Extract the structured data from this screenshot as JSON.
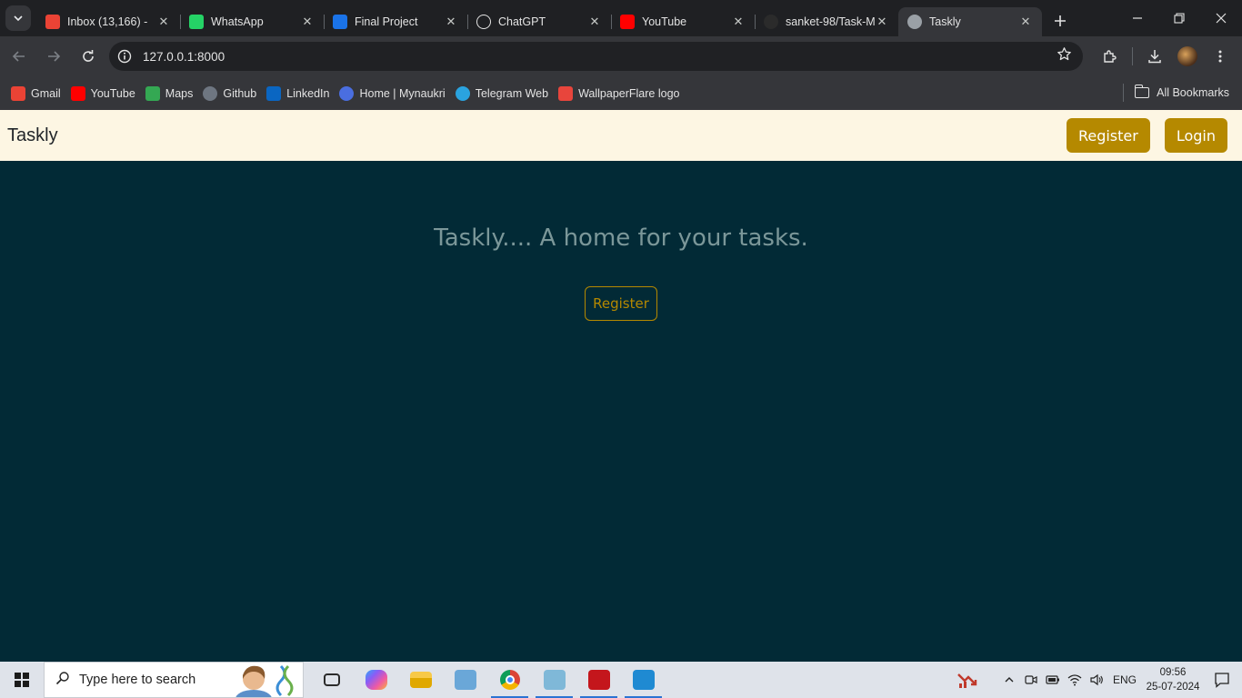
{
  "browser": {
    "tabs": [
      {
        "title": "Inbox (13,166) -",
        "favicon": "gmail-icon",
        "color": "#ea4335",
        "active": false
      },
      {
        "title": "WhatsApp",
        "favicon": "whatsapp-icon",
        "color": "#25d366",
        "active": false
      },
      {
        "title": "Final Project",
        "favicon": "google-classroom-icon",
        "color": "#1a73e8",
        "active": false
      },
      {
        "title": "ChatGPT",
        "favicon": "chatgpt-icon",
        "color": "#ffffff",
        "active": false
      },
      {
        "title": "YouTube",
        "favicon": "youtube-icon",
        "color": "#ff0000",
        "active": false
      },
      {
        "title": "sanket-98/Task-M",
        "favicon": "github-icon",
        "color": "#2b2b2b",
        "active": false
      },
      {
        "title": "Taskly",
        "favicon": "globe-icon",
        "color": "#9aa0a6",
        "active": true
      }
    ],
    "address": {
      "url": "127.0.0.1:8000"
    },
    "bookmarks": [
      {
        "label": "Gmail",
        "icon": "gmail-icon",
        "color": "#ea4335"
      },
      {
        "label": "YouTube",
        "icon": "youtube-icon",
        "color": "#ff0000"
      },
      {
        "label": "Maps",
        "icon": "maps-icon",
        "color": "#34a853"
      },
      {
        "label": "Github",
        "icon": "github-icon",
        "color": "#6e7681"
      },
      {
        "label": "LinkedIn",
        "icon": "linkedin-icon",
        "color": "#0a66c2"
      },
      {
        "label": "Home | Mynaukri",
        "icon": "naukri-icon",
        "color": "#4a6ee0"
      },
      {
        "label": "Telegram Web",
        "icon": "telegram-icon",
        "color": "#2aa3df"
      },
      {
        "label": "WallpaperFlare logo",
        "icon": "wallpaperflare-icon",
        "color": "#e8453c"
      }
    ],
    "all_bookmarks_label": "All Bookmarks"
  },
  "page": {
    "brand": "Taskly",
    "nav_register": "Register",
    "nav_login": "Login",
    "hero_title": "Taskly.... A home for your tasks.",
    "hero_register": "Register",
    "colors": {
      "navbar_bg": "#fdf6e3",
      "page_bg": "#022a36",
      "accent": "#b58900",
      "hero_text": "#7b9799"
    }
  },
  "taskbar": {
    "search_placeholder": "Type here to search",
    "apps": [
      {
        "name": "task-view-icon",
        "color": "#2b2b2b",
        "active": false
      },
      {
        "name": "copilot-icon",
        "color": "#7b61ff",
        "active": false
      },
      {
        "name": "file-explorer-icon",
        "color": "#f2b705",
        "active": false
      },
      {
        "name": "computer-icon",
        "color": "#6aa7d8",
        "active": false
      },
      {
        "name": "chrome-icon",
        "color": "#db4437",
        "active": true
      },
      {
        "name": "notepad-icon",
        "color": "#7fb8d8",
        "active": true
      },
      {
        "name": "acrobat-icon",
        "color": "#c4161c",
        "active": true
      },
      {
        "name": "vscode-icon",
        "color": "#1f8ad2",
        "active": true
      }
    ],
    "language": "ENG",
    "time": "09:56",
    "date": "25-07-2024"
  }
}
